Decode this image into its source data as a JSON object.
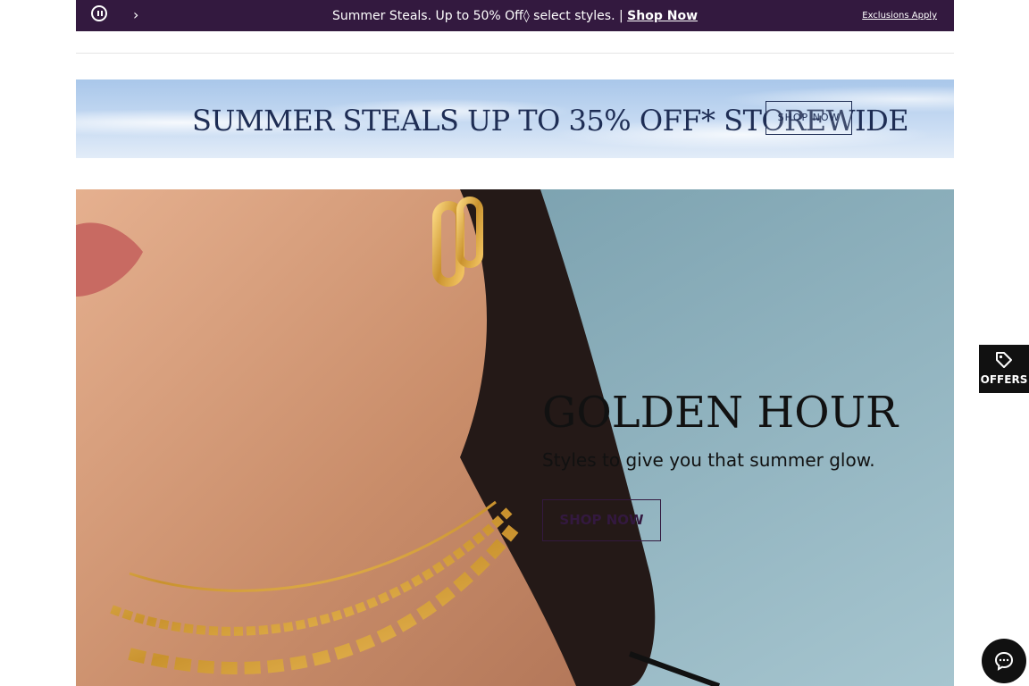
{
  "promo_bar": {
    "message": "Summer Steals. Up to 50% Off◊ select styles. |",
    "link": "Shop Now",
    "exclusions": "Exclusions Apply",
    "pause_icon": "pause-icon",
    "next_icon": "chevron-right-icon",
    "bg_color": "#33193f"
  },
  "summer_banner": {
    "headline": "SUMMER STEALS UP TO 35% OFF* STOREWIDE",
    "button": "SHOP NOW"
  },
  "hero": {
    "title": "GOLDEN HOUR",
    "subtitle": "Styles to give you that summer glow.",
    "button": "SHOP NOW"
  },
  "offers_tab": {
    "label": "OFFERS",
    "icon": "tag-icon"
  },
  "chat": {
    "icon": "chat-icon"
  }
}
